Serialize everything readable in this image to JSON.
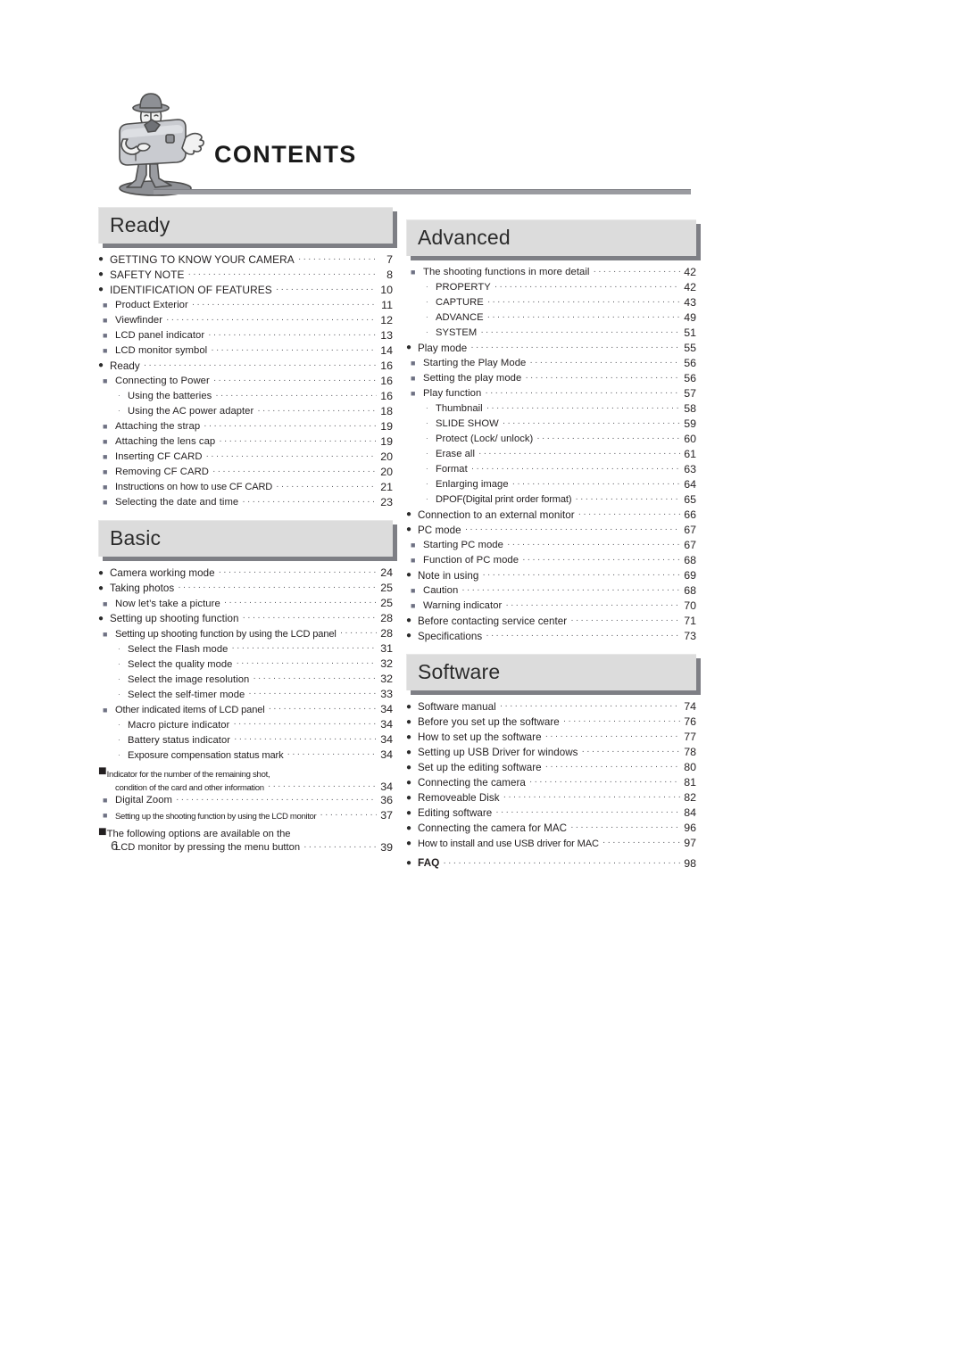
{
  "page": {
    "title": "CONTENTS",
    "page_number": "6",
    "mascot_icon": "camera-mascot-illustration",
    "colors": {
      "section_header_bg": "#dcdcdc",
      "section_header_shadow": "#7e7f85",
      "rule": "#9a9ba0",
      "text": "#231f20",
      "bullet_level1": "#2b2b2b",
      "bullet_level2": "#6e7183",
      "bullet_level3": "#4a4b52"
    },
    "bullets": {
      "level1": "●",
      "level2": "■",
      "level3": "·"
    }
  },
  "sections": [
    {
      "title": "Ready",
      "column": "left",
      "items": [
        {
          "label": "GETTING TO KNOW YOUR CAMERA",
          "page": "7",
          "level": 1,
          "style": "caps"
        },
        {
          "label": "SAFETY NOTE",
          "page": "8",
          "level": 1,
          "style": "caps"
        },
        {
          "label": "IDENTIFICATION OF FEATURES",
          "page": "10",
          "level": 1,
          "style": "caps"
        },
        {
          "label": "Product Exterior",
          "page": "11",
          "level": 2
        },
        {
          "label": "Viewfinder",
          "page": "12",
          "level": 2
        },
        {
          "label": "LCD panel indicator",
          "page": "13",
          "level": 2
        },
        {
          "label": "LCD monitor symbol",
          "page": "14",
          "level": 2
        },
        {
          "label": "Ready",
          "page": "16",
          "level": 1
        },
        {
          "label": "Connecting to Power",
          "page": "16",
          "level": 2
        },
        {
          "label": "Using the batteries",
          "page": "16",
          "level": 3
        },
        {
          "label": "Using the AC power adapter",
          "page": "18",
          "level": 3
        },
        {
          "label": "Attaching the strap",
          "page": "19",
          "level": 2
        },
        {
          "label": "Attaching the lens cap",
          "page": "19",
          "level": 2
        },
        {
          "label": "Inserting CF CARD",
          "page": "20",
          "level": 2
        },
        {
          "label": "Removing CF CARD",
          "page": "20",
          "level": 2
        },
        {
          "label": "Instructions on how to use CF CARD",
          "page": "21",
          "level": 2,
          "style": "tight"
        },
        {
          "label": "Selecting the date and time",
          "page": "23",
          "level": 2
        }
      ]
    },
    {
      "title": "Basic",
      "column": "left",
      "items": [
        {
          "label": "Camera working mode",
          "page": "24",
          "level": 1
        },
        {
          "label": "Taking photos",
          "page": "25",
          "level": 1
        },
        {
          "label": "Now let’s take a picture",
          "page": "25",
          "level": 2
        },
        {
          "label": "Setting up shooting function",
          "page": "28",
          "level": 1
        },
        {
          "label": "Setting up shooting function by using the LCD panel",
          "page": "28",
          "level": 2,
          "style": "tight"
        },
        {
          "label": "Select the Flash mode",
          "page": "31",
          "level": 3
        },
        {
          "label": "Select the quality mode",
          "page": "32",
          "level": 3
        },
        {
          "label": "Select the image resolution",
          "page": "32",
          "level": 3
        },
        {
          "label": "Select the self-timer mode",
          "page": "33",
          "level": 3
        },
        {
          "label": "Other indicated items of LCD panel",
          "page": "34",
          "level": 2,
          "style": "tight"
        },
        {
          "label": "Macro picture indicator",
          "page": "34",
          "level": 3
        },
        {
          "label": "Battery status indicator",
          "page": "34",
          "level": 3
        },
        {
          "label": "Exposure compensation status mark",
          "page": "34",
          "level": 3,
          "style": "tight"
        },
        {
          "label_line1": "Indicator for the number of the remaining shot,",
          "label_line2": "condition of the card and other information",
          "page": "34",
          "level": 2,
          "style": "wrap"
        },
        {
          "label": "Digital Zoom",
          "page": "36",
          "level": 2
        },
        {
          "label": "Setting up the shooting function by using the LCD monitor",
          "page": "37",
          "level": 2,
          "style": "xtight"
        },
        {
          "label_line1": "The following options are available on the",
          "label_line2": "LCD monitor by pressing the menu button",
          "page": "39",
          "level": 2,
          "style": "wrap-normal"
        }
      ]
    },
    {
      "title": "Advanced",
      "column": "right",
      "items": [
        {
          "label": "The shooting functions in more detail",
          "page": "42",
          "level": 2
        },
        {
          "label": "PROPERTY",
          "page": "42",
          "level": 3
        },
        {
          "label": "CAPTURE",
          "page": "43",
          "level": 3
        },
        {
          "label": "ADVANCE",
          "page": "49",
          "level": 3
        },
        {
          "label": "SYSTEM",
          "page": "51",
          "level": 3
        },
        {
          "label": "Play mode",
          "page": "55",
          "level": 1
        },
        {
          "label": "Starting the Play Mode",
          "page": "56",
          "level": 2
        },
        {
          "label": "Setting the play mode",
          "page": "56",
          "level": 2
        },
        {
          "label": "Play function",
          "page": "57",
          "level": 2
        },
        {
          "label": "Thumbnail",
          "page": "58",
          "level": 3
        },
        {
          "label": "SLIDE SHOW",
          "page": "59",
          "level": 3
        },
        {
          "label": "Protect (Lock/ unlock)",
          "page": "60",
          "level": 3
        },
        {
          "label": "Erase all",
          "page": "61",
          "level": 3
        },
        {
          "label": "Format",
          "page": "63",
          "level": 3
        },
        {
          "label": "Enlarging image",
          "page": "64",
          "level": 3
        },
        {
          "label": "DPOF(Digital print order format)",
          "page": "65",
          "level": 3,
          "style": "tight"
        },
        {
          "label": "Connection to an external monitor",
          "page": "66",
          "level": 1
        },
        {
          "label": "PC mode",
          "page": "67",
          "level": 1
        },
        {
          "label": "Starting PC mode",
          "page": "67",
          "level": 2
        },
        {
          "label": "Function of PC mode",
          "page": "68",
          "level": 2
        },
        {
          "label": "Note in using",
          "page": "69",
          "level": 1
        },
        {
          "label": "Caution",
          "page": "68",
          "level": 2
        },
        {
          "label": "Warning indicator",
          "page": "70",
          "level": 2
        },
        {
          "label": "Before contacting service center",
          "page": "71",
          "level": 1
        },
        {
          "label": "Specifications",
          "page": "73",
          "level": 1
        }
      ]
    },
    {
      "title": "Software",
      "column": "right",
      "items": [
        {
          "label": "Software manual",
          "page": "74",
          "level": 1
        },
        {
          "label": "Before you set up the software",
          "page": "76",
          "level": 1
        },
        {
          "label": "How to set up the software",
          "page": "77",
          "level": 1
        },
        {
          "label": "Setting up USB Driver for windows",
          "page": "78",
          "level": 1
        },
        {
          "label": "Set up the editing software",
          "page": "80",
          "level": 1
        },
        {
          "label": "Connecting the camera",
          "page": "81",
          "level": 1
        },
        {
          "label": "Removeable Disk",
          "page": "82",
          "level": 1
        },
        {
          "label": "Editing software",
          "page": "84",
          "level": 1
        },
        {
          "label": "Connecting the camera for MAC",
          "page": "96",
          "level": 1
        },
        {
          "label": "How to install and use USB driver for MAC",
          "page": "97",
          "level": 1,
          "style": "tight"
        },
        {
          "label": "FAQ",
          "page": "98",
          "level": 1,
          "style": "faq"
        }
      ]
    }
  ]
}
